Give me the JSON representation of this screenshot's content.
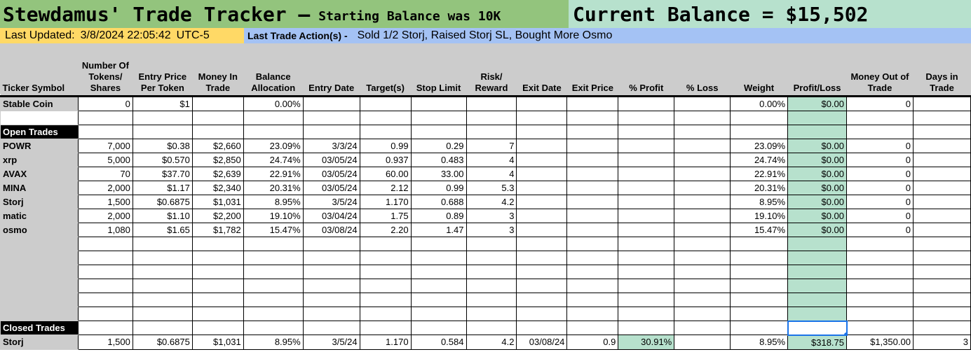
{
  "banner": {
    "title": "Stewdamus' Trade Tracker –",
    "subtitle": "Starting Balance was 10K",
    "balance": "Current Balance = $15,502"
  },
  "status": {
    "updated_label": "Last Updated:",
    "updated_value": "3/8/2024 22:05:42",
    "updated_tz": "UTC-5",
    "action_label": "Last Trade Action(s) -",
    "action_text": "Sold 1/2 Storj, Raised Storj SL, Bought More Osmo"
  },
  "colors": {
    "banner_left": "#93c47d",
    "banner_right": "#b7e1cd",
    "updated_bar": "#ffd966",
    "action_bar": "#a4c2f4",
    "header_grey": "#cccccc",
    "profit_green": "#b7e1cd"
  },
  "columns": [
    "Ticker Symbol",
    "Number Of Tokens/ Shares",
    "Entry Price Per Token",
    "Money In Trade",
    "Balance Allocation",
    "Entry Date",
    "Target(s)",
    "Stop Limit",
    "Risk/ Reward",
    "Exit Date",
    "Exit Price",
    "% Profit",
    "% Loss",
    "Weight",
    "Profit/Loss",
    "Money Out of Trade",
    "Days in Trade"
  ],
  "rows": [
    {
      "type": "data",
      "cells": [
        "Stable Coin",
        "0",
        "$1",
        "",
        "0.00%",
        "",
        "",
        "",
        "",
        "",
        "",
        "",
        "",
        "0.00%",
        "$0.00",
        "0",
        ""
      ]
    },
    {
      "type": "blank",
      "cells": [
        "",
        "",
        "",
        "",
        "",
        "",
        "",
        "",
        "",
        "",
        "",
        "",
        "",
        "",
        "",
        "",
        ""
      ]
    },
    {
      "type": "section",
      "cells": [
        "Open Trades",
        "",
        "",
        "",
        "",
        "",
        "",
        "",
        "",
        "",
        "",
        "",
        "",
        "",
        "",
        "",
        ""
      ]
    },
    {
      "type": "data",
      "cells": [
        "POWR",
        "7,000",
        "$0.38",
        "$2,660",
        "23.09%",
        "3/3/24",
        "0.99",
        "0.29",
        "7",
        "",
        "",
        "",
        "",
        "23.09%",
        "$0.00",
        "0",
        ""
      ]
    },
    {
      "type": "data",
      "cells": [
        "xrp",
        "5,000",
        "$0.570",
        "$2,850",
        "24.74%",
        "03/05/24",
        "0.937",
        "0.483",
        "4",
        "",
        "",
        "",
        "",
        "24.74%",
        "$0.00",
        "0",
        ""
      ]
    },
    {
      "type": "data",
      "cells": [
        "AVAX",
        "70",
        "$37.70",
        "$2,639",
        "22.91%",
        "03/05/24",
        "60.00",
        "33.00",
        "4",
        "",
        "",
        "",
        "",
        "22.91%",
        "$0.00",
        "0",
        ""
      ]
    },
    {
      "type": "data",
      "cells": [
        "MINA",
        "2,000",
        "$1.17",
        "$2,340",
        "20.31%",
        "03/05/24",
        "2.12",
        "0.99",
        "5.3",
        "",
        "",
        "",
        "",
        "20.31%",
        "$0.00",
        "0",
        ""
      ]
    },
    {
      "type": "data",
      "cells": [
        "Storj",
        "1,500",
        "$0.6875",
        "$1,031",
        "8.95%",
        "3/5/24",
        "1.170",
        "0.688",
        "4.2",
        "",
        "",
        "",
        "",
        "8.95%",
        "$0.00",
        "0",
        ""
      ]
    },
    {
      "type": "data",
      "cells": [
        "matic",
        "2,000",
        "$1.10",
        "$2,200",
        "19.10%",
        "03/04/24",
        "1.75",
        "0.89",
        "3",
        "",
        "",
        "",
        "",
        "19.10%",
        "$0.00",
        "0",
        ""
      ]
    },
    {
      "type": "data",
      "cells": [
        "osmo",
        "1,080",
        "$1.65",
        "$1,782",
        "15.47%",
        "03/08/24",
        "2.20",
        "1.47",
        "3",
        "",
        "",
        "",
        "",
        "15.47%",
        "$0.00",
        "0",
        ""
      ]
    },
    {
      "type": "empty",
      "cells": [
        "",
        "",
        "",
        "",
        "",
        "",
        "",
        "",
        "",
        "",
        "",
        "",
        "",
        "",
        "",
        "",
        ""
      ]
    },
    {
      "type": "empty",
      "cells": [
        "",
        "",
        "",
        "",
        "",
        "",
        "",
        "",
        "",
        "",
        "",
        "",
        "",
        "",
        "",
        "",
        ""
      ]
    },
    {
      "type": "empty",
      "cells": [
        "",
        "",
        "",
        "",
        "",
        "",
        "",
        "",
        "",
        "",
        "",
        "",
        "",
        "",
        "",
        "",
        ""
      ]
    },
    {
      "type": "empty",
      "cells": [
        "",
        "",
        "",
        "",
        "",
        "",
        "",
        "",
        "",
        "",
        "",
        "",
        "",
        "",
        "",
        "",
        ""
      ]
    },
    {
      "type": "empty",
      "cells": [
        "",
        "",
        "",
        "",
        "",
        "",
        "",
        "",
        "",
        "",
        "",
        "",
        "",
        "",
        "",
        "",
        ""
      ]
    },
    {
      "type": "empty",
      "cells": [
        "",
        "",
        "",
        "",
        "",
        "",
        "",
        "",
        "",
        "",
        "",
        "",
        "",
        "",
        "",
        "",
        ""
      ]
    },
    {
      "type": "section",
      "cells": [
        "Closed Trades",
        "",
        "",
        "",
        "",
        "",
        "",
        "",
        "",
        "",
        "",
        "",
        "",
        "",
        "",
        "",
        ""
      ]
    },
    {
      "type": "data",
      "cells": [
        "Storj",
        "1,500",
        "$0.6875",
        "$1,031",
        "8.95%",
        "3/5/24",
        "1.170",
        "0.584",
        "4.2",
        "03/08/24",
        "0.9",
        "30.91%",
        "",
        "8.95%",
        "$318.75",
        "$1,350.00",
        "3"
      ]
    }
  ]
}
